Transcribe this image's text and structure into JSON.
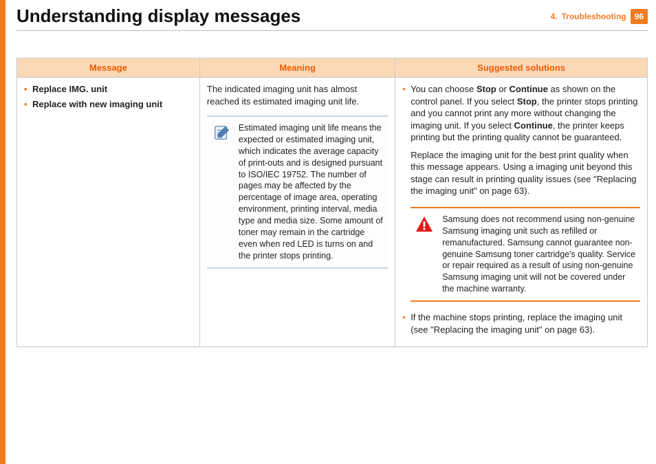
{
  "header": {
    "title": "Understanding display messages",
    "section_num": "4.",
    "section_name": "Troubleshooting",
    "page": "96"
  },
  "table": {
    "headers": {
      "c1": "Message",
      "c2": "Meaning",
      "c3": "Suggested solutions"
    },
    "row": {
      "messages": [
        "Replace IMG. unit",
        "Replace with new imaging unit"
      ],
      "meaning_intro": "The indicated imaging unit has almost reached its estimated imaging unit life.",
      "note": "Estimated imaging unit life means the expected or estimated imaging unit, which indicates the average capacity of print-outs and is designed pursuant to ISO/IEC 19752. The number of pages may be affected by the percentage of image area, operating environment, printing interval, media type and media size. Some amount of toner may remain in the cartridge even when red LED is turns on and the printer stops printing.",
      "sol1_pre": "You can choose ",
      "sol1_b1": "Stop",
      "sol1_mid1": " or ",
      "sol1_b2": "Continue",
      "sol1_mid2": " as shown on the control panel. If you select ",
      "sol1_b3": "Stop",
      "sol1_mid3": ", the printer stops printing and you cannot print any more without changing the imaging unit. If you select ",
      "sol1_b4": "Continue",
      "sol1_post": ", the printer keeps printing but the printing quality cannot be guaranteed.",
      "sol1_para2": "Replace the imaging unit for the best print quality when this message appears. Using a imaging unit beyond this stage can result in printing quality issues (see \"Replacing the imaging unit\" on page 63).",
      "warn": "Samsung does not recommend using non-genuine Samsung imaging unit such as refilled or remanufactured. Samsung cannot guarantee non-genuine Samsung toner cartridge's quality. Service or repair required as a result of using non-genuine Samsung imaging unit will not be covered under the machine warranty.",
      "sol2": "If the machine stops printing, replace the imaging unit (see \"Replacing the imaging unit\" on page 63)."
    }
  }
}
